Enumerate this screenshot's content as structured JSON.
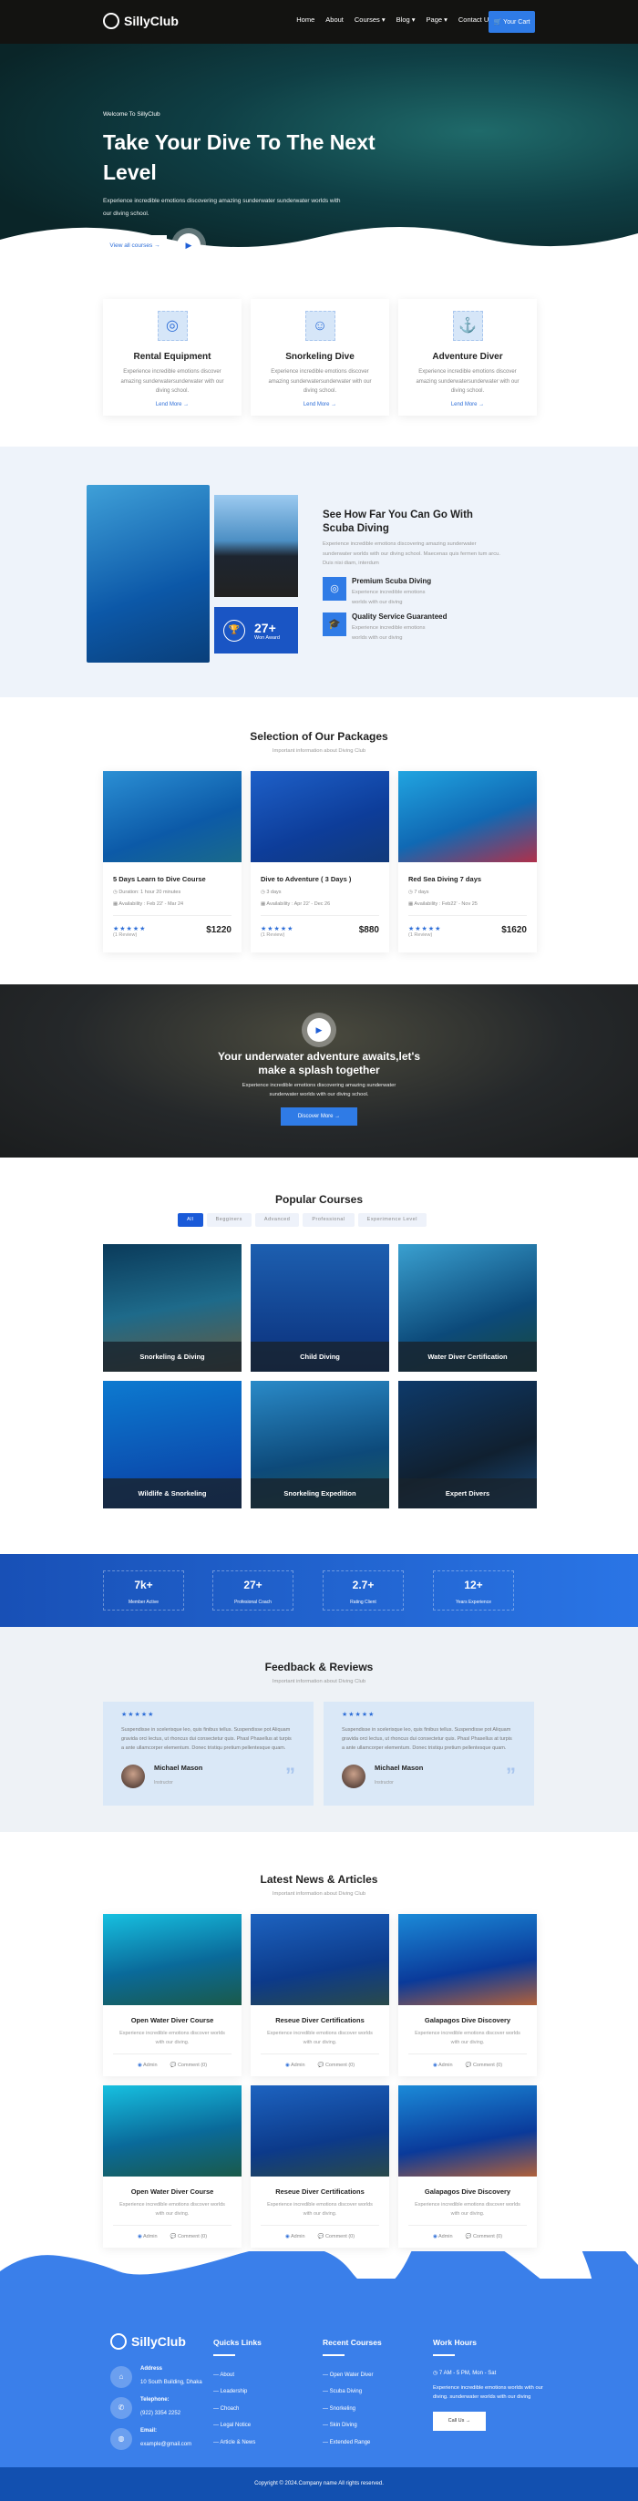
{
  "brand": {
    "name": "SillyClub",
    "accent": "#2f7be6",
    "nav_bg": "#131311",
    "footer_bg": "#3a7fea"
  },
  "nav": {
    "items": [
      "Home",
      "About",
      "Courses ▾",
      "Blog ▾",
      "Page ▾",
      "Contact Us"
    ],
    "cart": "Your Cart"
  },
  "hero": {
    "welcome": "Welcome To SillyClub",
    "title": "Take Your Dive To The Next Level",
    "desc": "Experience incredible emotions discovering amazing sunderwater sunderwater worlds with our diving school.",
    "button": "View all courses →"
  },
  "services": [
    {
      "icon": "snorkel-mask-icon",
      "title": "Rental Equipment",
      "desc": "Experience incredible emotions discover amazing sunderwatersunderwater with our diving school.",
      "link": "Lend More →"
    },
    {
      "icon": "diver-icon",
      "title": "Snorkeling Dive",
      "desc": "Experience incredible emotions discover amazing sunderwatersunderwater with our diving school.",
      "link": "Lend More →"
    },
    {
      "icon": "adventure-diver-icon",
      "title": "Adventure Diver",
      "desc": "Experience incredible emotions discover amazing sunderwatersunderwater with our diving school.",
      "link": "Lend More →"
    }
  ],
  "about": {
    "award_value": "27+",
    "award_label": "Won Award",
    "title": "See How Far You Can Go With Scuba Diving",
    "desc": "Experience incredible emotions discovering amazing sunderwater sunderwater worlds with our diving school. Maecenas quis fermen tum arcu. Duis nisi diam, interdum",
    "features": [
      {
        "title": "Premium Scuba Diving",
        "desc": "Experience incredible emotions worlds with our diving"
      },
      {
        "title": "Quality Service Guaranteed",
        "desc": "Experience incredible emotions worlds with our diving"
      }
    ]
  },
  "packages": {
    "title": "Selection of Our Packages",
    "subtitle": "Important information about Diving Club",
    "items": [
      {
        "title": "5 Days Learn to Dive Course",
        "duration": "Duration: 1 hour 20 minutes",
        "availability": "Availability : Feb 22' - Mar 24",
        "rating": 5,
        "reviews": "(1 Review)",
        "price": "$1220"
      },
      {
        "title": "Dive to Adventure ( 3 Days )",
        "duration": "3 days",
        "availability": "Availability : Apr 22' - Dec 26",
        "rating": 5,
        "reviews": "(1 Review)",
        "price": "$880"
      },
      {
        "title": "Red Sea Diving 7 days",
        "duration": "7 days",
        "availability": "Availability : Feb22' - Nov 25",
        "rating": 5,
        "reviews": "(1 Review)",
        "price": "$1620"
      }
    ]
  },
  "banner": {
    "title": "Your underwater adventure awaits,let's make a splash together",
    "desc": "Experience incredible emotions discovering amazing sunderwater sunderwater worlds with our diving school.",
    "button": "Discover More →"
  },
  "courses": {
    "title": "Popular Courses",
    "tabs": [
      "All",
      "Begginers",
      "Advanced",
      "Professional",
      "Experimence Level"
    ],
    "active_tab": "All",
    "items": [
      "Snorkeling & Diving",
      "Child Diving",
      "Water Diver Certification",
      "Wildlife & Snorkeling",
      "Snorkeling Expedition",
      "Expert Divers"
    ]
  },
  "stats": [
    {
      "value": "7k+",
      "label": "Member Active"
    },
    {
      "value": "27+",
      "label": "Profesional Coach"
    },
    {
      "value": "2.7+",
      "label": "Rating Client"
    },
    {
      "value": "12+",
      "label": "Years Experience"
    }
  ],
  "feedback": {
    "title": "Feedback & Reviews",
    "subtitle": "Important information about Diving Club",
    "items": [
      {
        "rating": 5,
        "text": "Suspendisse in scelerisque leo, quis finibus tellus. Suspendisse pot Aliquam gravida orci lectus, ut rhoncus dui consectetur quis. Phasl Phasellus at turpis a ante ullamcorper elementum. Donec tristiqu pretium pellentesque quam.",
        "name": "Michael Mason",
        "role": "Instructor"
      },
      {
        "rating": 5,
        "text": "Suspendisse in scelerisque leo, quis finibus tellus. Suspendisse pot Aliquam gravida orci lectus, ut rhoncus dui consectetur quis. Phasl Phasellus at turpis a ante ullamcorper elementum. Donec tristiqu pretium pellentesque quam.",
        "name": "Michael Mason",
        "role": "Instructor"
      }
    ]
  },
  "news": {
    "title": "Latest News & Articles",
    "subtitle": "Important information about Diving Club",
    "items": [
      {
        "title": "Open Water Diver Course",
        "desc": "Experience incredible emotions discover worlds with our diving.",
        "author": "Admin",
        "comments": "Comment (0)"
      },
      {
        "title": "Reseue Diver Certifications",
        "desc": "Experience incredible emotions discover worlds with our diving.",
        "author": "Admin",
        "comments": "Comment (0)"
      },
      {
        "title": "Galapagos Dive Discovery",
        "desc": "Experience incredible emotions discover worlds with our diving.",
        "author": "Admin",
        "comments": "Comment (0)"
      },
      {
        "title": "Open Water Diver Course",
        "desc": "Experience incredible emotions discover worlds with our diving.",
        "author": "Admin",
        "comments": "Comment (0)"
      },
      {
        "title": "Reseue Diver Certifications",
        "desc": "Experience incredible emotions discover worlds with our diving.",
        "author": "Admin",
        "comments": "Comment (0)"
      },
      {
        "title": "Galapagos Dive Discovery",
        "desc": "Experience incredible emotions discover worlds with our diving.",
        "author": "Admin",
        "comments": "Comment (0)"
      }
    ]
  },
  "footer": {
    "contact": [
      {
        "icon": "home-icon",
        "label": "Address",
        "value": "10 South Building, Dhaka"
      },
      {
        "icon": "phone-icon",
        "label": "Telephone:",
        "value": "(922) 3354 2252"
      },
      {
        "icon": "globe-icon",
        "label": "Email:",
        "value": "example@gmail.com"
      }
    ],
    "quick_title": "Quicks Links",
    "quick": [
      "About",
      "Leadership",
      "Choach",
      "Legal Notice",
      "Article & News"
    ],
    "recent_title": "Recent Courses",
    "recent": [
      "Open Water Diver",
      "Scuba Diving",
      "Snorkeling",
      "Skin Diving",
      "Extended Range"
    ],
    "hours_title": "Work Hours",
    "hours": "7 AM - 5 PM, Mon - Sat",
    "hours_desc": "Experience incredible emotions worlds with our diving. sunderwater worlds with our diving",
    "call": "Call Us →",
    "copyright": "Copyright © 2024.Company name All rights reserved."
  }
}
